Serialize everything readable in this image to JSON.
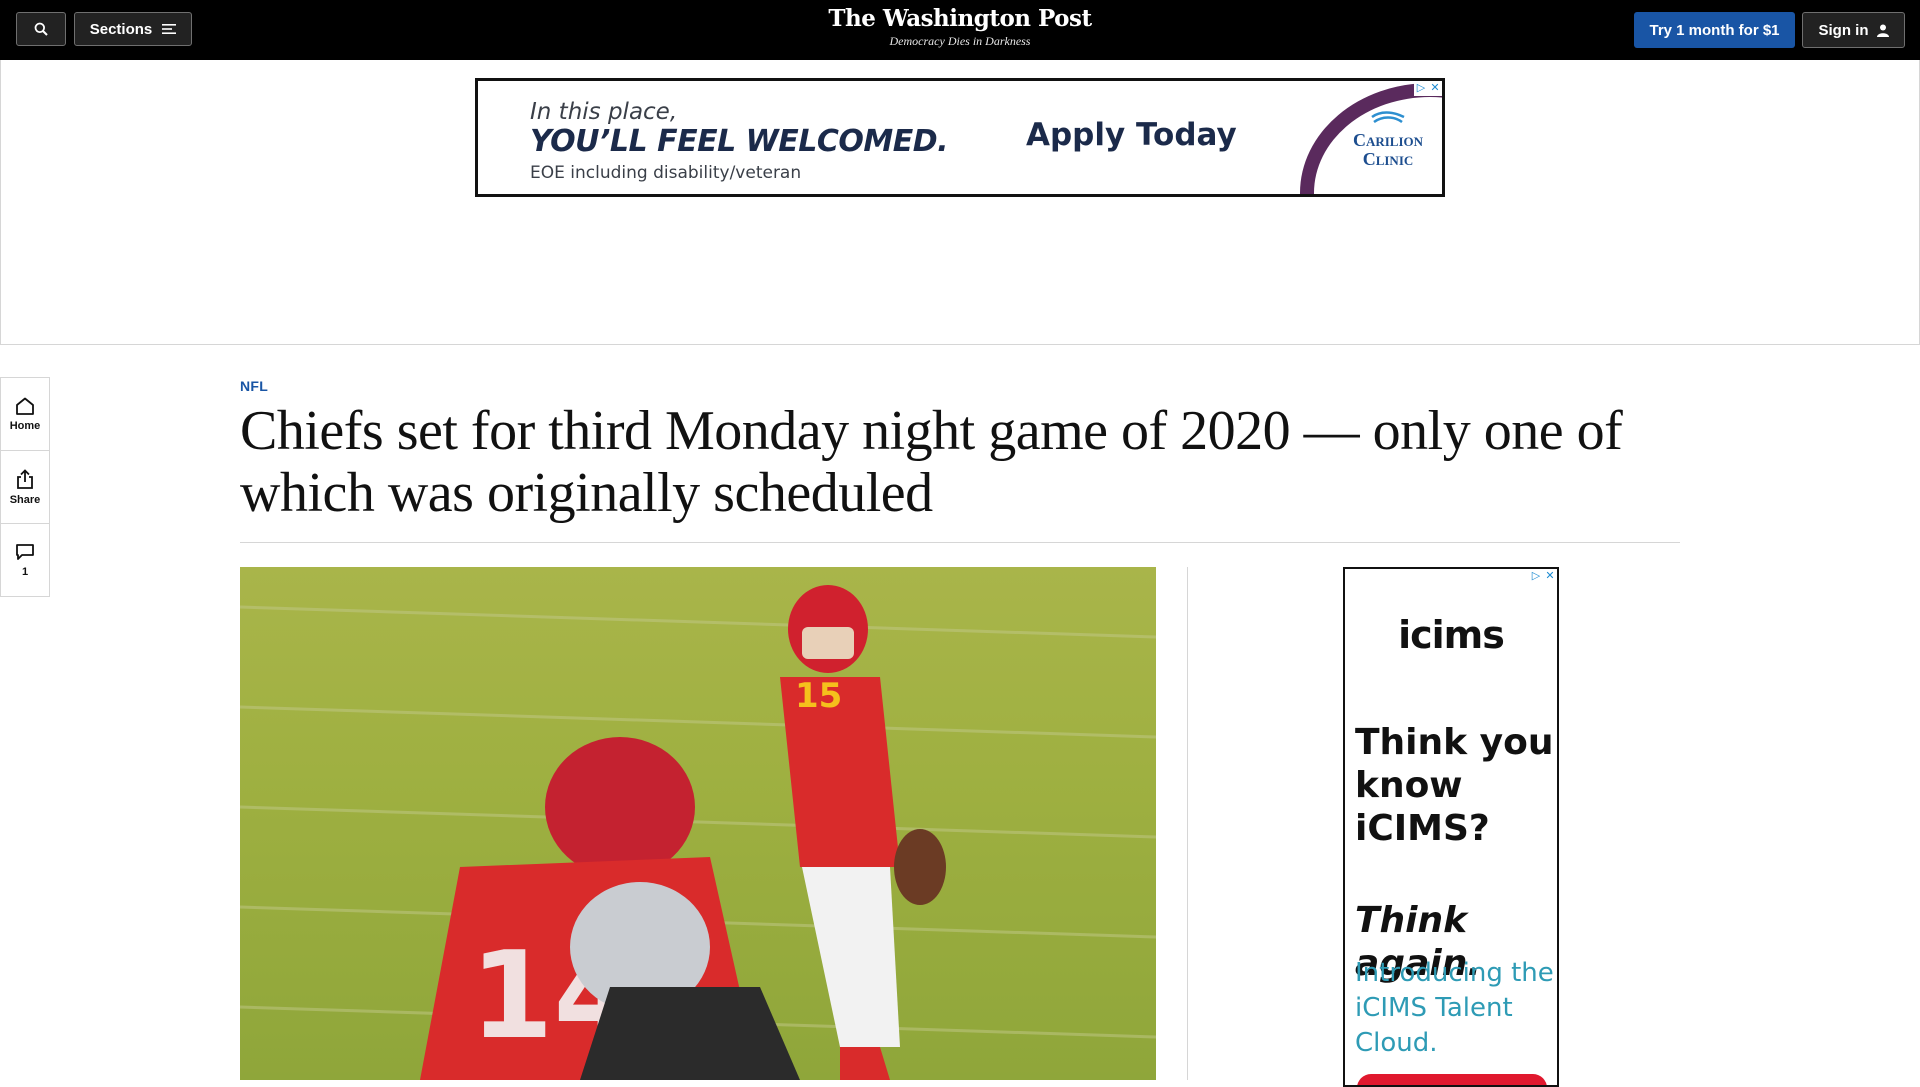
{
  "header": {
    "sections_label": "Sections",
    "logo": "The Washington Post",
    "tagline": "Democracy Dies in Darkness",
    "subscribe_label": "Try 1 month for $1",
    "signin_label": "Sign in"
  },
  "banner_ad": {
    "line1": "In this place,",
    "line2": "YOU’LL FEEL WELCOMED.",
    "line3": "EOE including disability/veteran",
    "cta": "Apply Today",
    "brand_line1": "Carilion",
    "brand_line2": "Clinic",
    "arc_color": "#5a2a5d"
  },
  "rail": {
    "home_label": "Home",
    "share_label": "Share",
    "comments_count": "1"
  },
  "article": {
    "kicker": "NFL",
    "headline": "Chiefs set for third Monday night game of 2020 — only one of which was originally scheduled"
  },
  "hero_image": {
    "description_icons": [
      "football-player-icon"
    ],
    "jersey_front": "15",
    "jersey_back": "14"
  },
  "side_ad": {
    "logo": "icims",
    "headline_line1": "Think you know iCIMS?",
    "headline_line2": "Think again.",
    "body": "Introducing the iCIMS Talent Cloud.",
    "accent_color": "#2e9bb5",
    "cta_color": "#e0182e"
  },
  "colors": {
    "brand_blue": "#1955a5",
    "topbar": "#000000"
  }
}
